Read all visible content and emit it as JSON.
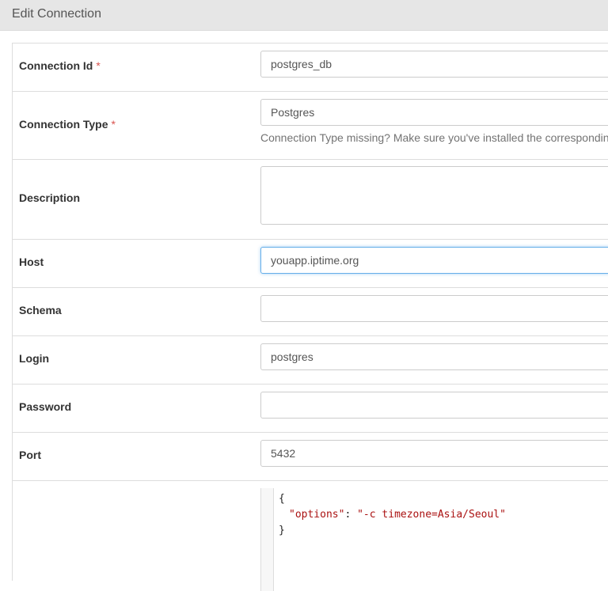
{
  "header": {
    "title": "Edit Connection"
  },
  "fields": {
    "conn_id": {
      "label": "Connection Id",
      "required": "*",
      "value": "postgres_db"
    },
    "conn_type": {
      "label": "Connection Type",
      "required": "*",
      "value": "Postgres",
      "help": "Connection Type missing? Make sure you've installed the correspondin"
    },
    "description": {
      "label": "Description",
      "value": ""
    },
    "host": {
      "label": "Host",
      "value": "youapp.iptime.org"
    },
    "schema": {
      "label": "Schema",
      "value": ""
    },
    "login": {
      "label": "Login",
      "value": "postgres"
    },
    "password": {
      "label": "Password",
      "value": ""
    },
    "port": {
      "label": "Port",
      "value": "5432"
    }
  },
  "extra": {
    "line1": "{",
    "key": "\"options\"",
    "sep": ": ",
    "val": "\"-c timezone=Asia/Seoul\"",
    "line3": "}"
  },
  "colors": {
    "required": "#d9534f",
    "focus_border": "#66afe9",
    "json_string": "#aa1111"
  }
}
